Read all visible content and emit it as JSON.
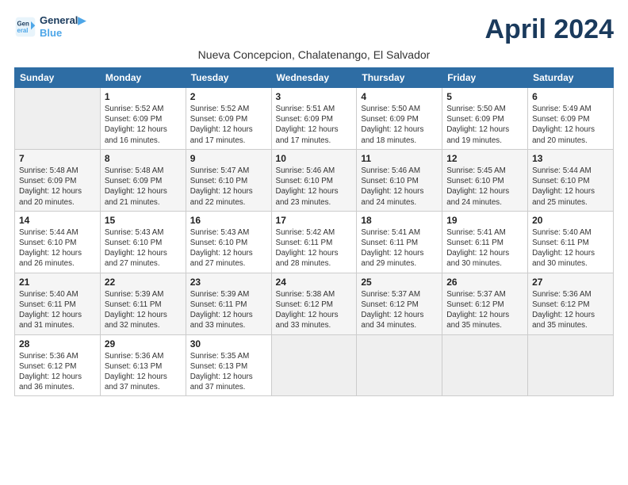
{
  "header": {
    "logo_line1": "General",
    "logo_line2": "Blue",
    "month_title": "April 2024",
    "subtitle": "Nueva Concepcion, Chalatenango, El Salvador"
  },
  "weekdays": [
    "Sunday",
    "Monday",
    "Tuesday",
    "Wednesday",
    "Thursday",
    "Friday",
    "Saturday"
  ],
  "weeks": [
    [
      {
        "day": "",
        "info": ""
      },
      {
        "day": "1",
        "info": "Sunrise: 5:52 AM\nSunset: 6:09 PM\nDaylight: 12 hours\nand 16 minutes."
      },
      {
        "day": "2",
        "info": "Sunrise: 5:52 AM\nSunset: 6:09 PM\nDaylight: 12 hours\nand 17 minutes."
      },
      {
        "day": "3",
        "info": "Sunrise: 5:51 AM\nSunset: 6:09 PM\nDaylight: 12 hours\nand 17 minutes."
      },
      {
        "day": "4",
        "info": "Sunrise: 5:50 AM\nSunset: 6:09 PM\nDaylight: 12 hours\nand 18 minutes."
      },
      {
        "day": "5",
        "info": "Sunrise: 5:50 AM\nSunset: 6:09 PM\nDaylight: 12 hours\nand 19 minutes."
      },
      {
        "day": "6",
        "info": "Sunrise: 5:49 AM\nSunset: 6:09 PM\nDaylight: 12 hours\nand 20 minutes."
      }
    ],
    [
      {
        "day": "7",
        "info": "Sunrise: 5:48 AM\nSunset: 6:09 PM\nDaylight: 12 hours\nand 20 minutes."
      },
      {
        "day": "8",
        "info": "Sunrise: 5:48 AM\nSunset: 6:09 PM\nDaylight: 12 hours\nand 21 minutes."
      },
      {
        "day": "9",
        "info": "Sunrise: 5:47 AM\nSunset: 6:10 PM\nDaylight: 12 hours\nand 22 minutes."
      },
      {
        "day": "10",
        "info": "Sunrise: 5:46 AM\nSunset: 6:10 PM\nDaylight: 12 hours\nand 23 minutes."
      },
      {
        "day": "11",
        "info": "Sunrise: 5:46 AM\nSunset: 6:10 PM\nDaylight: 12 hours\nand 24 minutes."
      },
      {
        "day": "12",
        "info": "Sunrise: 5:45 AM\nSunset: 6:10 PM\nDaylight: 12 hours\nand 24 minutes."
      },
      {
        "day": "13",
        "info": "Sunrise: 5:44 AM\nSunset: 6:10 PM\nDaylight: 12 hours\nand 25 minutes."
      }
    ],
    [
      {
        "day": "14",
        "info": "Sunrise: 5:44 AM\nSunset: 6:10 PM\nDaylight: 12 hours\nand 26 minutes."
      },
      {
        "day": "15",
        "info": "Sunrise: 5:43 AM\nSunset: 6:10 PM\nDaylight: 12 hours\nand 27 minutes."
      },
      {
        "day": "16",
        "info": "Sunrise: 5:43 AM\nSunset: 6:10 PM\nDaylight: 12 hours\nand 27 minutes."
      },
      {
        "day": "17",
        "info": "Sunrise: 5:42 AM\nSunset: 6:11 PM\nDaylight: 12 hours\nand 28 minutes."
      },
      {
        "day": "18",
        "info": "Sunrise: 5:41 AM\nSunset: 6:11 PM\nDaylight: 12 hours\nand 29 minutes."
      },
      {
        "day": "19",
        "info": "Sunrise: 5:41 AM\nSunset: 6:11 PM\nDaylight: 12 hours\nand 30 minutes."
      },
      {
        "day": "20",
        "info": "Sunrise: 5:40 AM\nSunset: 6:11 PM\nDaylight: 12 hours\nand 30 minutes."
      }
    ],
    [
      {
        "day": "21",
        "info": "Sunrise: 5:40 AM\nSunset: 6:11 PM\nDaylight: 12 hours\nand 31 minutes."
      },
      {
        "day": "22",
        "info": "Sunrise: 5:39 AM\nSunset: 6:11 PM\nDaylight: 12 hours\nand 32 minutes."
      },
      {
        "day": "23",
        "info": "Sunrise: 5:39 AM\nSunset: 6:11 PM\nDaylight: 12 hours\nand 33 minutes."
      },
      {
        "day": "24",
        "info": "Sunrise: 5:38 AM\nSunset: 6:12 PM\nDaylight: 12 hours\nand 33 minutes."
      },
      {
        "day": "25",
        "info": "Sunrise: 5:37 AM\nSunset: 6:12 PM\nDaylight: 12 hours\nand 34 minutes."
      },
      {
        "day": "26",
        "info": "Sunrise: 5:37 AM\nSunset: 6:12 PM\nDaylight: 12 hours\nand 35 minutes."
      },
      {
        "day": "27",
        "info": "Sunrise: 5:36 AM\nSunset: 6:12 PM\nDaylight: 12 hours\nand 35 minutes."
      }
    ],
    [
      {
        "day": "28",
        "info": "Sunrise: 5:36 AM\nSunset: 6:12 PM\nDaylight: 12 hours\nand 36 minutes."
      },
      {
        "day": "29",
        "info": "Sunrise: 5:36 AM\nSunset: 6:13 PM\nDaylight: 12 hours\nand 37 minutes."
      },
      {
        "day": "30",
        "info": "Sunrise: 5:35 AM\nSunset: 6:13 PM\nDaylight: 12 hours\nand 37 minutes."
      },
      {
        "day": "",
        "info": ""
      },
      {
        "day": "",
        "info": ""
      },
      {
        "day": "",
        "info": ""
      },
      {
        "day": "",
        "info": ""
      }
    ]
  ]
}
